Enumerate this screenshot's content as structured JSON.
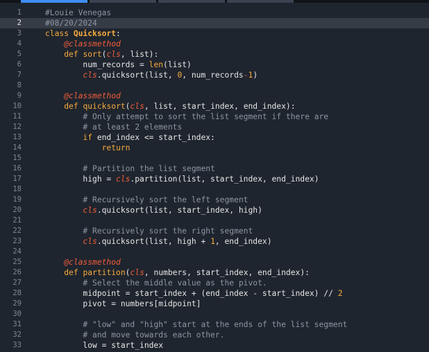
{
  "editor": {
    "tabs": [
      {
        "active": true
      },
      {
        "active": false
      },
      {
        "active": false
      },
      {
        "active": false
      }
    ],
    "current_line": 2,
    "colors": {
      "background": "#1f252e",
      "current_line": "#363c46",
      "comment": "#8d96a3",
      "keyword": "#f6ab3e",
      "decorator": "#f25c3b",
      "accent_tab": "#3e8ef5"
    },
    "lines": [
      {
        "n": "1",
        "tokens": [
          [
            "c",
            "#Louie Venegas"
          ]
        ]
      },
      {
        "n": "2",
        "tokens": [
          [
            "c",
            "#08/20/2024"
          ]
        ]
      },
      {
        "n": "3",
        "tokens": [
          [
            "k",
            "class "
          ],
          [
            "title",
            "Quicksort"
          ],
          [
            "p",
            ":"
          ]
        ]
      },
      {
        "n": "4",
        "tokens": [
          [
            "p",
            "    "
          ],
          [
            "d",
            "@classmethod"
          ]
        ]
      },
      {
        "n": "5",
        "tokens": [
          [
            "p",
            "    "
          ],
          [
            "k",
            "def "
          ],
          [
            "f",
            "sort"
          ],
          [
            "p",
            "("
          ],
          [
            "cls",
            "cls"
          ],
          [
            "p",
            ", list):"
          ]
        ]
      },
      {
        "n": "6",
        "tokens": [
          [
            "p",
            "        num_records = "
          ],
          [
            "b",
            "len"
          ],
          [
            "p",
            "(list)"
          ]
        ]
      },
      {
        "n": "7",
        "tokens": [
          [
            "p",
            "        "
          ],
          [
            "cls",
            "cls"
          ],
          [
            "p",
            ".quicksort(list, "
          ],
          [
            "n",
            "0"
          ],
          [
            "p",
            ", num_records"
          ],
          [
            "op",
            "-"
          ],
          [
            "n",
            "1"
          ],
          [
            "p",
            ")"
          ]
        ]
      },
      {
        "n": "8",
        "tokens": []
      },
      {
        "n": "9",
        "tokens": [
          [
            "p",
            "    "
          ],
          [
            "d",
            "@classmethod"
          ]
        ]
      },
      {
        "n": "10",
        "tokens": [
          [
            "p",
            "    "
          ],
          [
            "k",
            "def "
          ],
          [
            "f",
            "quicksort"
          ],
          [
            "p",
            "("
          ],
          [
            "cls",
            "cls"
          ],
          [
            "p",
            ", list, start_index, end_index):"
          ]
        ]
      },
      {
        "n": "11",
        "tokens": [
          [
            "p",
            "        "
          ],
          [
            "c",
            "# Only attempt to sort the list segment if there are"
          ]
        ]
      },
      {
        "n": "12",
        "tokens": [
          [
            "p",
            "        "
          ],
          [
            "c",
            "# at least 2 elements"
          ]
        ]
      },
      {
        "n": "13",
        "tokens": [
          [
            "p",
            "        "
          ],
          [
            "k",
            "if "
          ],
          [
            "p",
            "end_index <= start_index:"
          ]
        ]
      },
      {
        "n": "14",
        "tokens": [
          [
            "p",
            "            "
          ],
          [
            "k",
            "return"
          ]
        ]
      },
      {
        "n": "15",
        "tokens": []
      },
      {
        "n": "16",
        "tokens": [
          [
            "p",
            "        "
          ],
          [
            "c",
            "# Partition the list segment"
          ]
        ]
      },
      {
        "n": "17",
        "tokens": [
          [
            "p",
            "        high = "
          ],
          [
            "cls",
            "cls"
          ],
          [
            "p",
            ".partition(list, start_index, end_index)"
          ]
        ]
      },
      {
        "n": "18",
        "tokens": []
      },
      {
        "n": "19",
        "tokens": [
          [
            "p",
            "        "
          ],
          [
            "c",
            "# Recursively sort the left segment"
          ]
        ]
      },
      {
        "n": "20",
        "tokens": [
          [
            "p",
            "        "
          ],
          [
            "cls",
            "cls"
          ],
          [
            "p",
            ".quicksort(list, start_index, high)"
          ]
        ]
      },
      {
        "n": "21",
        "tokens": []
      },
      {
        "n": "22",
        "tokens": [
          [
            "p",
            "        "
          ],
          [
            "c",
            "# Recursively sort the right segment"
          ]
        ]
      },
      {
        "n": "23",
        "tokens": [
          [
            "p",
            "        "
          ],
          [
            "cls",
            "cls"
          ],
          [
            "p",
            ".quicksort(list, high + "
          ],
          [
            "n",
            "1"
          ],
          [
            "p",
            ", end_index)"
          ]
        ]
      },
      {
        "n": "24",
        "tokens": []
      },
      {
        "n": "25",
        "tokens": [
          [
            "p",
            "    "
          ],
          [
            "d",
            "@classmethod"
          ]
        ]
      },
      {
        "n": "26",
        "tokens": [
          [
            "p",
            "    "
          ],
          [
            "k",
            "def "
          ],
          [
            "f",
            "partition"
          ],
          [
            "p",
            "("
          ],
          [
            "cls",
            "cls"
          ],
          [
            "p",
            ", numbers, start_index, end_index):"
          ]
        ]
      },
      {
        "n": "27",
        "tokens": [
          [
            "p",
            "        "
          ],
          [
            "c",
            "# Select the middle value as the pivot."
          ]
        ]
      },
      {
        "n": "28",
        "tokens": [
          [
            "p",
            "        midpoint = start_index + (end_index - start_index) // "
          ],
          [
            "n",
            "2"
          ]
        ]
      },
      {
        "n": "29",
        "tokens": [
          [
            "p",
            "        pivot = numbers[midpoint]"
          ]
        ]
      },
      {
        "n": "30",
        "tokens": []
      },
      {
        "n": "31",
        "tokens": [
          [
            "p",
            "        "
          ],
          [
            "c",
            "# \"low\" and \"high\" start at the ends of the list segment"
          ]
        ]
      },
      {
        "n": "32",
        "tokens": [
          [
            "p",
            "        "
          ],
          [
            "c",
            "# and move towards each other."
          ]
        ]
      },
      {
        "n": "33",
        "tokens": [
          [
            "p",
            "        low = start_index"
          ]
        ]
      }
    ]
  }
}
